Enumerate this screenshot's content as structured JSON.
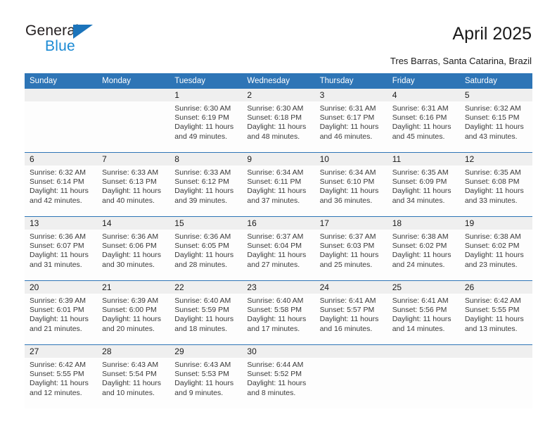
{
  "brand": {
    "name_dark": "General",
    "name_blue": "Blue",
    "accent_blue": "#2e75b6",
    "logo_blue": "#1b8ad4"
  },
  "header": {
    "title": "April 2025",
    "subtitle": "Tres Barras, Santa Catarina, Brazil"
  },
  "calendar": {
    "weekdays": [
      "Sunday",
      "Monday",
      "Tuesday",
      "Wednesday",
      "Thursday",
      "Friday",
      "Saturday"
    ],
    "weeks": [
      [
        {
          "day": "",
          "lines": [
            "",
            "",
            "",
            ""
          ]
        },
        {
          "day": "",
          "lines": [
            "",
            "",
            "",
            ""
          ]
        },
        {
          "day": "1",
          "lines": [
            "Sunrise: 6:30 AM",
            "Sunset: 6:19 PM",
            "Daylight: 11 hours",
            "and 49 minutes."
          ]
        },
        {
          "day": "2",
          "lines": [
            "Sunrise: 6:30 AM",
            "Sunset: 6:18 PM",
            "Daylight: 11 hours",
            "and 48 minutes."
          ]
        },
        {
          "day": "3",
          "lines": [
            "Sunrise: 6:31 AM",
            "Sunset: 6:17 PM",
            "Daylight: 11 hours",
            "and 46 minutes."
          ]
        },
        {
          "day": "4",
          "lines": [
            "Sunrise: 6:31 AM",
            "Sunset: 6:16 PM",
            "Daylight: 11 hours",
            "and 45 minutes."
          ]
        },
        {
          "day": "5",
          "lines": [
            "Sunrise: 6:32 AM",
            "Sunset: 6:15 PM",
            "Daylight: 11 hours",
            "and 43 minutes."
          ]
        }
      ],
      [
        {
          "day": "6",
          "lines": [
            "Sunrise: 6:32 AM",
            "Sunset: 6:14 PM",
            "Daylight: 11 hours",
            "and 42 minutes."
          ]
        },
        {
          "day": "7",
          "lines": [
            "Sunrise: 6:33 AM",
            "Sunset: 6:13 PM",
            "Daylight: 11 hours",
            "and 40 minutes."
          ]
        },
        {
          "day": "8",
          "lines": [
            "Sunrise: 6:33 AM",
            "Sunset: 6:12 PM",
            "Daylight: 11 hours",
            "and 39 minutes."
          ]
        },
        {
          "day": "9",
          "lines": [
            "Sunrise: 6:34 AM",
            "Sunset: 6:11 PM",
            "Daylight: 11 hours",
            "and 37 minutes."
          ]
        },
        {
          "day": "10",
          "lines": [
            "Sunrise: 6:34 AM",
            "Sunset: 6:10 PM",
            "Daylight: 11 hours",
            "and 36 minutes."
          ]
        },
        {
          "day": "11",
          "lines": [
            "Sunrise: 6:35 AM",
            "Sunset: 6:09 PM",
            "Daylight: 11 hours",
            "and 34 minutes."
          ]
        },
        {
          "day": "12",
          "lines": [
            "Sunrise: 6:35 AM",
            "Sunset: 6:08 PM",
            "Daylight: 11 hours",
            "and 33 minutes."
          ]
        }
      ],
      [
        {
          "day": "13",
          "lines": [
            "Sunrise: 6:36 AM",
            "Sunset: 6:07 PM",
            "Daylight: 11 hours",
            "and 31 minutes."
          ]
        },
        {
          "day": "14",
          "lines": [
            "Sunrise: 6:36 AM",
            "Sunset: 6:06 PM",
            "Daylight: 11 hours",
            "and 30 minutes."
          ]
        },
        {
          "day": "15",
          "lines": [
            "Sunrise: 6:36 AM",
            "Sunset: 6:05 PM",
            "Daylight: 11 hours",
            "and 28 minutes."
          ]
        },
        {
          "day": "16",
          "lines": [
            "Sunrise: 6:37 AM",
            "Sunset: 6:04 PM",
            "Daylight: 11 hours",
            "and 27 minutes."
          ]
        },
        {
          "day": "17",
          "lines": [
            "Sunrise: 6:37 AM",
            "Sunset: 6:03 PM",
            "Daylight: 11 hours",
            "and 25 minutes."
          ]
        },
        {
          "day": "18",
          "lines": [
            "Sunrise: 6:38 AM",
            "Sunset: 6:02 PM",
            "Daylight: 11 hours",
            "and 24 minutes."
          ]
        },
        {
          "day": "19",
          "lines": [
            "Sunrise: 6:38 AM",
            "Sunset: 6:02 PM",
            "Daylight: 11 hours",
            "and 23 minutes."
          ]
        }
      ],
      [
        {
          "day": "20",
          "lines": [
            "Sunrise: 6:39 AM",
            "Sunset: 6:01 PM",
            "Daylight: 11 hours",
            "and 21 minutes."
          ]
        },
        {
          "day": "21",
          "lines": [
            "Sunrise: 6:39 AM",
            "Sunset: 6:00 PM",
            "Daylight: 11 hours",
            "and 20 minutes."
          ]
        },
        {
          "day": "22",
          "lines": [
            "Sunrise: 6:40 AM",
            "Sunset: 5:59 PM",
            "Daylight: 11 hours",
            "and 18 minutes."
          ]
        },
        {
          "day": "23",
          "lines": [
            "Sunrise: 6:40 AM",
            "Sunset: 5:58 PM",
            "Daylight: 11 hours",
            "and 17 minutes."
          ]
        },
        {
          "day": "24",
          "lines": [
            "Sunrise: 6:41 AM",
            "Sunset: 5:57 PM",
            "Daylight: 11 hours",
            "and 16 minutes."
          ]
        },
        {
          "day": "25",
          "lines": [
            "Sunrise: 6:41 AM",
            "Sunset: 5:56 PM",
            "Daylight: 11 hours",
            "and 14 minutes."
          ]
        },
        {
          "day": "26",
          "lines": [
            "Sunrise: 6:42 AM",
            "Sunset: 5:55 PM",
            "Daylight: 11 hours",
            "and 13 minutes."
          ]
        }
      ],
      [
        {
          "day": "27",
          "lines": [
            "Sunrise: 6:42 AM",
            "Sunset: 5:55 PM",
            "Daylight: 11 hours",
            "and 12 minutes."
          ]
        },
        {
          "day": "28",
          "lines": [
            "Sunrise: 6:43 AM",
            "Sunset: 5:54 PM",
            "Daylight: 11 hours",
            "and 10 minutes."
          ]
        },
        {
          "day": "29",
          "lines": [
            "Sunrise: 6:43 AM",
            "Sunset: 5:53 PM",
            "Daylight: 11 hours",
            "and 9 minutes."
          ]
        },
        {
          "day": "30",
          "lines": [
            "Sunrise: 6:44 AM",
            "Sunset: 5:52 PM",
            "Daylight: 11 hours",
            "and 8 minutes."
          ]
        },
        {
          "day": "",
          "lines": [
            "",
            "",
            "",
            ""
          ]
        },
        {
          "day": "",
          "lines": [
            "",
            "",
            "",
            ""
          ]
        },
        {
          "day": "",
          "lines": [
            "",
            "",
            "",
            ""
          ]
        }
      ]
    ]
  }
}
